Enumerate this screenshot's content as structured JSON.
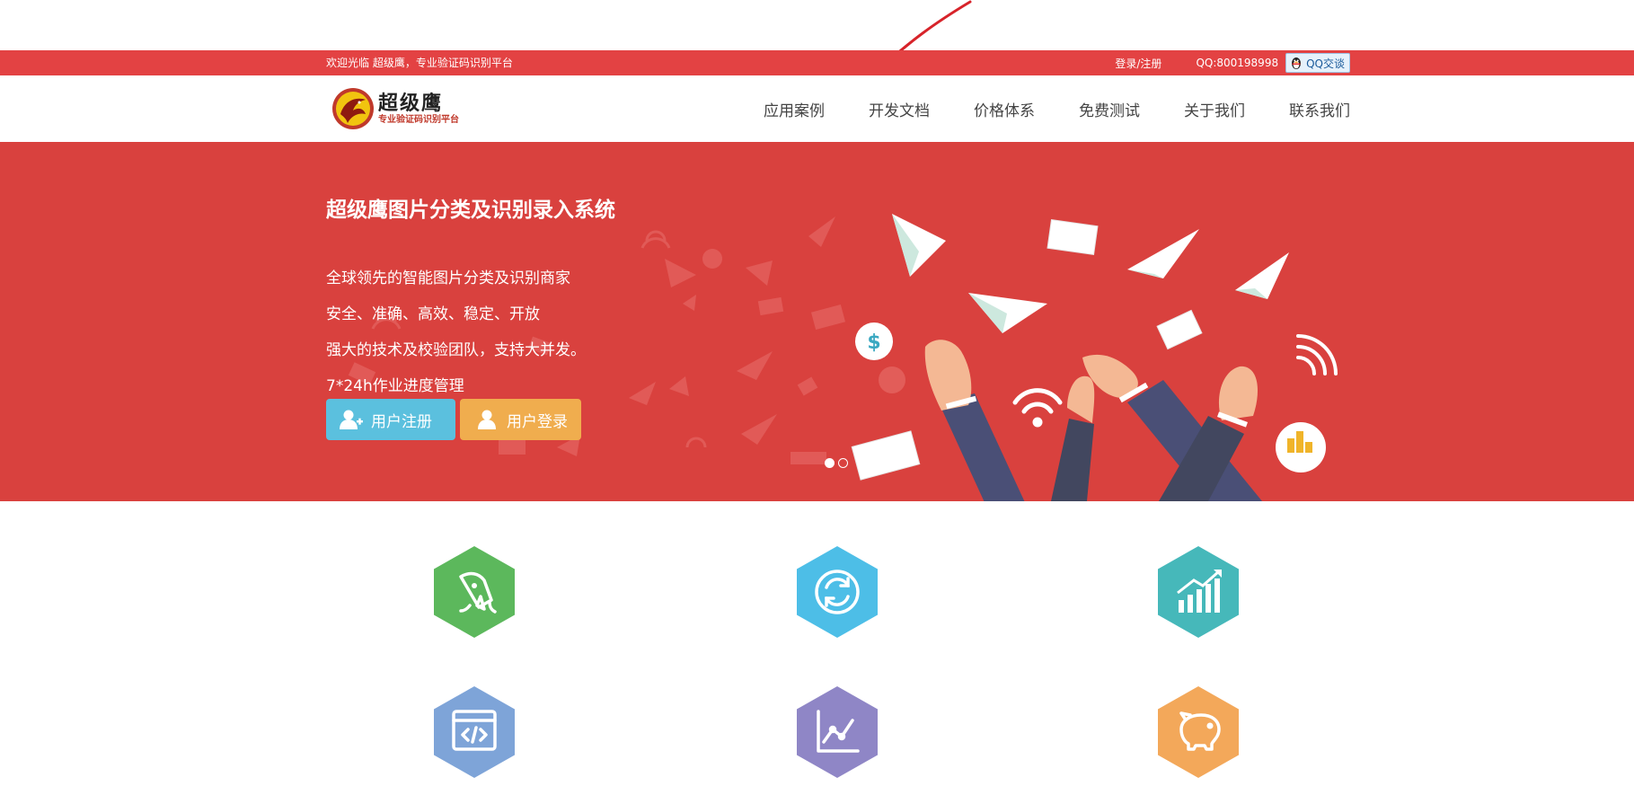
{
  "topbar": {
    "welcome": "欢迎光临 超级鹰，专业验证码识别平台",
    "login_register": "登录/注册",
    "qq_number": "QQ:800198998",
    "qq_chat": "QQ交谈"
  },
  "logo": {
    "name": "超级鹰",
    "tagline": "专业验证码识别平台"
  },
  "nav": {
    "items": [
      "应用案例",
      "开发文档",
      "价格体系",
      "免费测试",
      "关于我们",
      "联系我们"
    ]
  },
  "hero": {
    "title": "超级鹰图片分类及识别录入系统",
    "lines": [
      "全球领先的智能图片分类及识别商家",
      "安全、准确、高效、稳定、开放",
      "强大的技术及校验团队，支持大并发。",
      "7*24h作业进度管理"
    ],
    "register_button": "用户注册",
    "login_button": "用户登录",
    "slides_total": 2,
    "slide_active": 1
  },
  "features": {
    "icons": [
      {
        "icon": "rocket-icon",
        "color": "#5cb85c"
      },
      {
        "icon": "refresh-icon",
        "color": "#4dbee7"
      },
      {
        "icon": "bar-chart-up-icon",
        "color": "#46b8ba"
      },
      {
        "icon": "code-window-icon",
        "color": "#7ea4d8"
      },
      {
        "icon": "line-chart-icon",
        "color": "#8f86c6"
      },
      {
        "icon": "piggy-bank-icon",
        "color": "#f3a85a"
      }
    ]
  },
  "colors": {
    "topbar": "#e34243",
    "hero": "#d9413e",
    "annotation": "#d7232a"
  }
}
